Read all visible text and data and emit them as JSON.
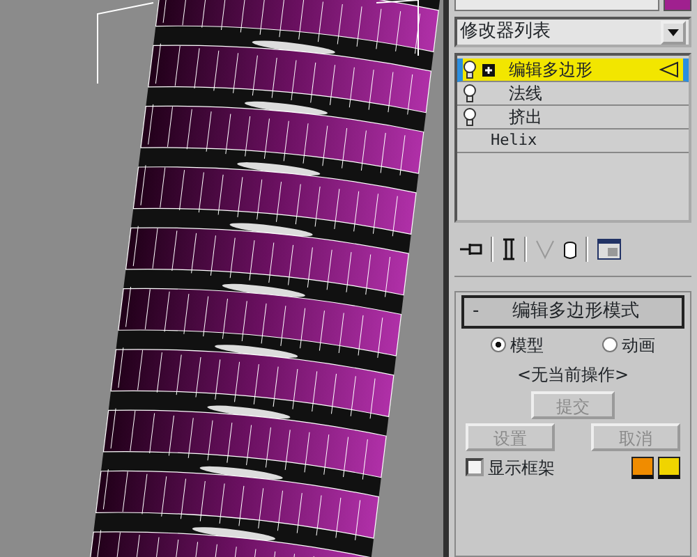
{
  "modifier_list": {
    "value": "修改器列表"
  },
  "stack": [
    {
      "kind": "modifier",
      "label": "编辑多边形",
      "selected": true,
      "expanded": false
    },
    {
      "kind": "modifier",
      "label": "法线",
      "selected": false
    },
    {
      "kind": "modifier",
      "label": "挤出",
      "selected": false
    },
    {
      "kind": "base",
      "label": "Helix",
      "selected": false
    }
  ],
  "rollout": {
    "sign": "-",
    "title": "编辑多边形模式",
    "radios": [
      {
        "label": "模型",
        "selected": true
      },
      {
        "label": "动画",
        "selected": false
      }
    ],
    "status": "<无当前操作>",
    "commit_button": {
      "label": "提交",
      "disabled": true
    },
    "buttons": [
      {
        "label": "设置",
        "disabled": true
      },
      {
        "label": "取消",
        "disabled": true
      }
    ],
    "checkbox": {
      "label": "显示框架",
      "checked": false
    },
    "swatches": [
      {
        "color": "#f08c00"
      },
      {
        "color": "#f0d400"
      }
    ]
  }
}
